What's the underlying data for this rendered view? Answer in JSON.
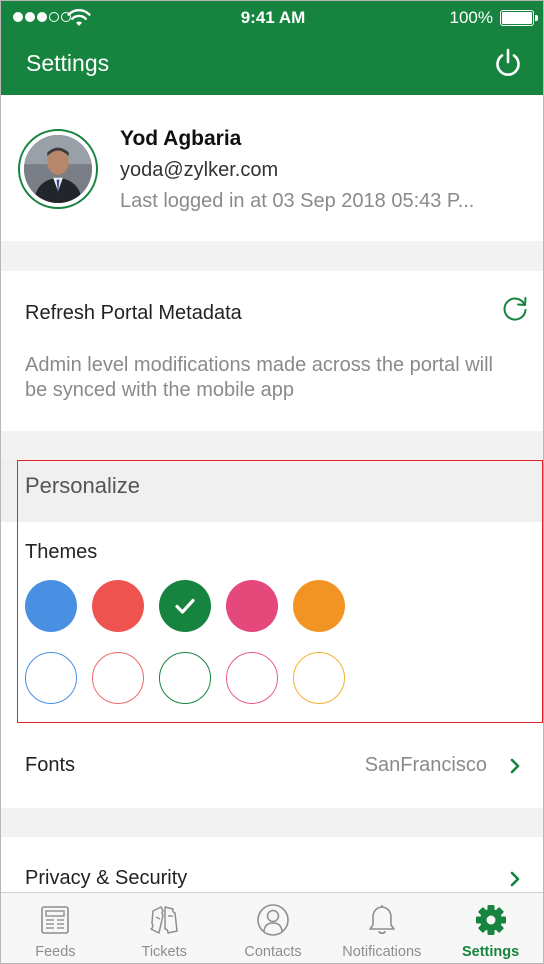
{
  "status_bar": {
    "time": "9:41 AM",
    "battery": "100%",
    "signal_dots_filled": 3,
    "signal_dots_total": 5
  },
  "header": {
    "title": "Settings",
    "power_icon": "power-icon"
  },
  "profile": {
    "name": "Yod Agbaria",
    "email": "yoda@zylker.com",
    "last_login": "Last logged in at 03 Sep 2018 05:43 P..."
  },
  "refresh": {
    "title": "Refresh Portal Metadata",
    "description": "Admin level modifications made across the portal will be synced with the mobile app",
    "icon": "refresh-icon"
  },
  "personalize": {
    "title": "Personalize",
    "themes_label": "Themes",
    "solid_themes": [
      {
        "name": "blue",
        "color": "#4a90e2",
        "selected": false
      },
      {
        "name": "red",
        "color": "#ef5350",
        "selected": false
      },
      {
        "name": "green",
        "color": "#16843f",
        "selected": true
      },
      {
        "name": "pink",
        "color": "#e5487a",
        "selected": false
      },
      {
        "name": "orange",
        "color": "#f29424",
        "selected": false
      }
    ],
    "outline_themes": [
      {
        "name": "blue-outline",
        "color": "#4a90e2"
      },
      {
        "name": "red-outline",
        "color": "#ef6b6b"
      },
      {
        "name": "green-outline",
        "color": "#16843f"
      },
      {
        "name": "pink-outline",
        "color": "#ea5a8c"
      },
      {
        "name": "orange-outline",
        "color": "#f2b134"
      }
    ]
  },
  "fonts": {
    "label": "Fonts",
    "value": "SanFrancisco"
  },
  "privacy": {
    "label": "Privacy & Security"
  },
  "tabbar": {
    "tabs": [
      {
        "label": "Feeds",
        "icon": "feeds-icon",
        "active": false
      },
      {
        "label": "Tickets",
        "icon": "tickets-icon",
        "active": false
      },
      {
        "label": "Contacts",
        "icon": "contacts-icon",
        "active": false
      },
      {
        "label": "Notifications",
        "icon": "notifications-icon",
        "active": false
      },
      {
        "label": "Settings",
        "icon": "settings-gear-icon",
        "active": true
      }
    ]
  },
  "colors": {
    "brand_green": "#16843f",
    "highlight_red": "#e0262b"
  }
}
